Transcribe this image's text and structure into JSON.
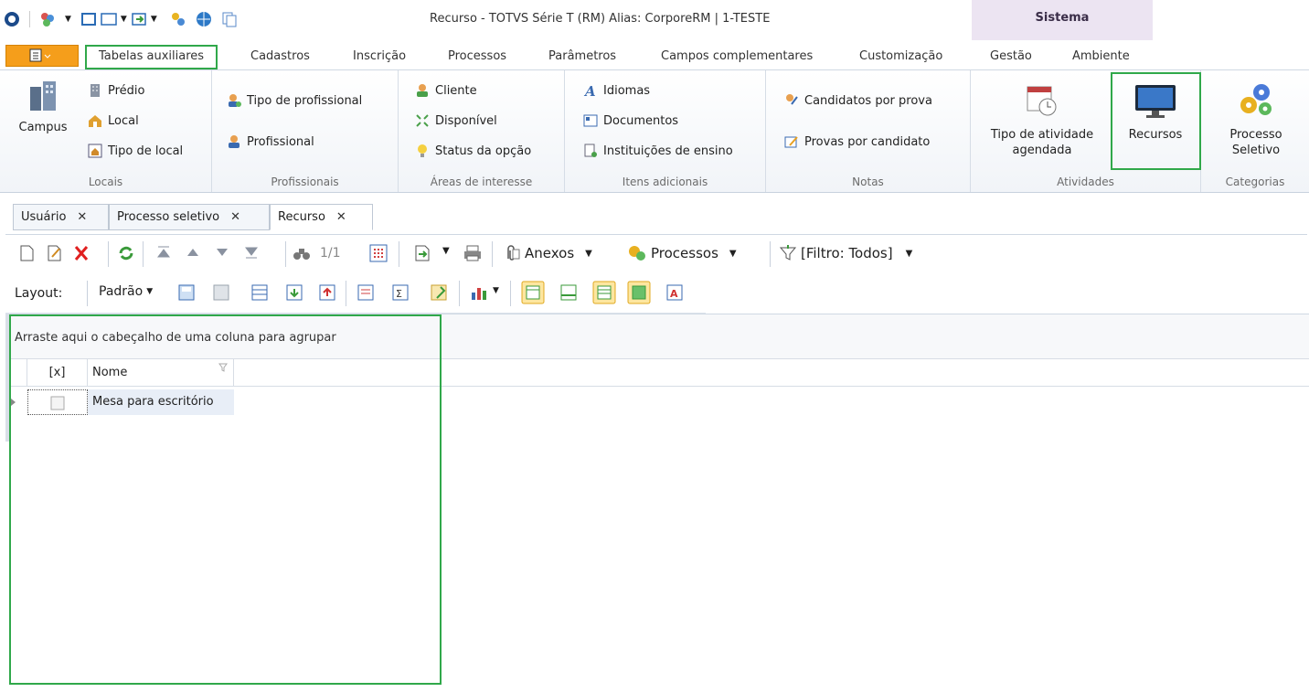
{
  "window": {
    "title": "Recurso - TOTVS Série T  (RM) Alias: CorporeRM | 1-TESTE",
    "context_tab": "Sistema"
  },
  "menu_tabs": [
    "Tabelas auxiliares",
    "Cadastros",
    "Inscrição",
    "Processos",
    "Parâmetros",
    "Campos complementares",
    "Customização",
    "Gestão",
    "Ambiente"
  ],
  "ribbon": {
    "locais": {
      "label": "Locais",
      "big": "Campus",
      "items": [
        "Prédio",
        "Local",
        "Tipo de local"
      ]
    },
    "profissionais": {
      "label": "Profissionais",
      "items": [
        "Tipo de profissional",
        "Profissional"
      ]
    },
    "areas": {
      "label": "Áreas de interesse",
      "items": [
        "Cliente",
        "Disponível",
        "Status da opção"
      ]
    },
    "itens": {
      "label": "Itens adicionais",
      "items": [
        "Idiomas",
        "Documentos",
        "Instituições de ensino"
      ]
    },
    "notas": {
      "label": "Notas",
      "items": [
        "Candidatos por prova",
        "Provas por candidato"
      ]
    },
    "atividades": {
      "label": "Atividades",
      "big1a": "Tipo de atividade",
      "big1b": "agendada",
      "big2": "Recursos"
    },
    "categorias": {
      "label": "Categorias",
      "bigA": "Processo",
      "bigB": "Seletivo"
    }
  },
  "doc_tabs": [
    "Usuário",
    "Processo seletivo",
    "Recurso"
  ],
  "toolbar": {
    "nav": "1/1",
    "anexos": "Anexos",
    "processos": "Processos",
    "filtro": "[Filtro: Todos]",
    "layout": "Layout:",
    "padrao": "Padrão"
  },
  "grid": {
    "group_hint": "Arraste aqui o cabeçalho de uma coluna para agrupar",
    "columns": [
      "[x]",
      "Nome"
    ],
    "rows": [
      {
        "nome": "Mesa para escritório"
      }
    ]
  }
}
